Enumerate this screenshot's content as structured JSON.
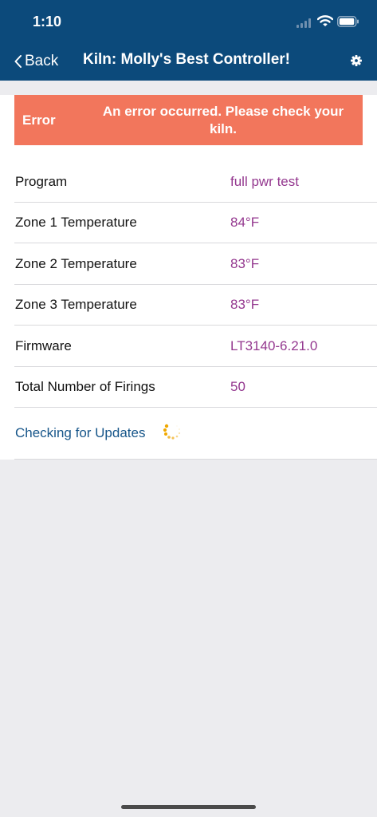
{
  "status_bar": {
    "time": "1:10"
  },
  "nav": {
    "back_label": "Back",
    "title": "Kiln: Molly's Best Controller!",
    "settings_icon": "gear-icon"
  },
  "error": {
    "label": "Error",
    "message": "An error occurred. Please check your kiln."
  },
  "details": [
    {
      "label": "Program",
      "value": "full pwr test"
    },
    {
      "label": "Zone 1 Temperature",
      "value": "84°F"
    },
    {
      "label": "Zone 2 Temperature",
      "value": "83°F"
    },
    {
      "label": "Zone 3 Temperature",
      "value": "83°F"
    },
    {
      "label": "Firmware",
      "value": "LT3140-6.21.0"
    },
    {
      "label": "Total Number of Firings",
      "value": "50"
    }
  ],
  "updates": {
    "label": "Checking for Updates"
  },
  "colors": {
    "header_bg": "#0c4a7b",
    "error_bg": "#f2765c",
    "value_text": "#94388f",
    "link_text": "#17568a",
    "spinner": "#f0a800"
  }
}
